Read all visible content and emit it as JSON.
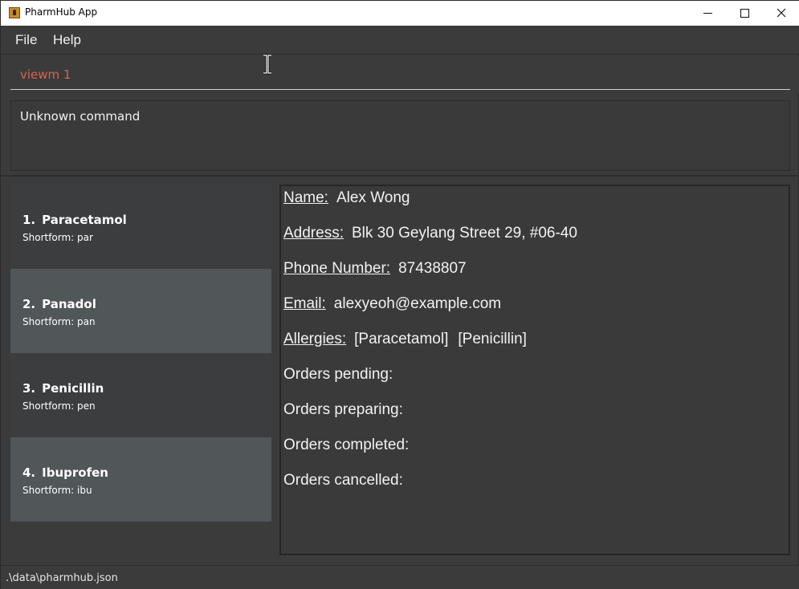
{
  "window": {
    "title": "PharmHub App"
  },
  "menu": {
    "file": "File",
    "help": "Help"
  },
  "command": {
    "value": "viewm 1"
  },
  "result": {
    "text": "Unknown command"
  },
  "medicines": [
    {
      "index": "1.",
      "name": "Paracetamol",
      "shortform": "Shortform: par"
    },
    {
      "index": "2.",
      "name": "Panadol",
      "shortform": "Shortform: pan"
    },
    {
      "index": "3.",
      "name": "Penicillin",
      "shortform": "Shortform: pen"
    },
    {
      "index": "4.",
      "name": "Ibuprofen",
      "shortform": "Shortform: ibu"
    }
  ],
  "person": {
    "name_label": "Name:",
    "name": "Alex Wong",
    "address_label": "Address:",
    "address": "Blk 30 Geylang Street 29, #06-40",
    "phone_label": "Phone Number:",
    "phone": "87438807",
    "email_label": "Email:",
    "email": "alexyeoh@example.com",
    "allergies_label": "Allergies:",
    "allergies": [
      "[Paracetamol]",
      "[Penicillin]"
    ],
    "orders_pending": "Orders pending:",
    "orders_preparing": "Orders preparing:",
    "orders_completed": "Orders completed:",
    "orders_cancelled": "Orders cancelled:"
  },
  "status": {
    "path": ".\\data\\pharmhub.json"
  }
}
